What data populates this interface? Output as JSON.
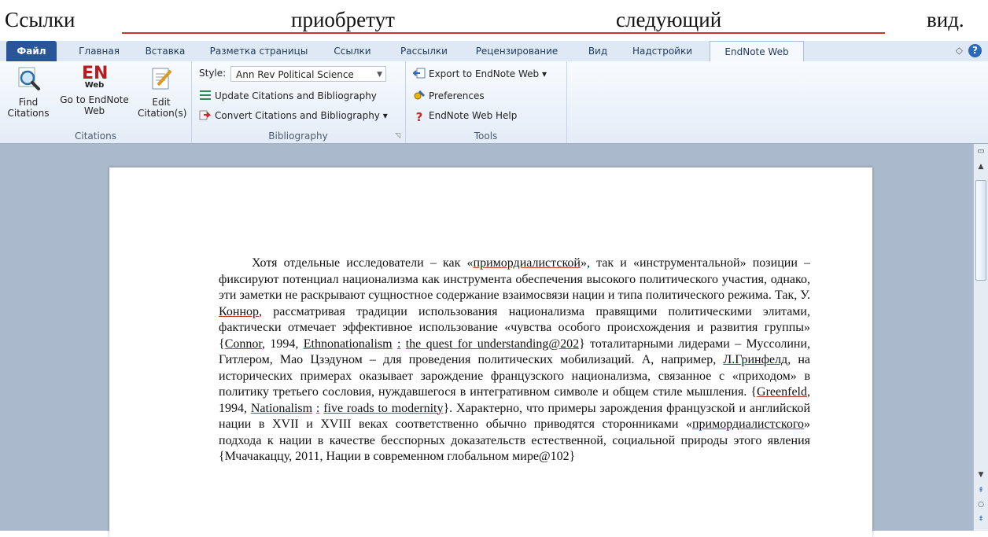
{
  "caption": {
    "words": [
      "Ссылки",
      "приобретут",
      "следующий",
      "вид."
    ]
  },
  "tabs": [
    {
      "label": "Файл"
    },
    {
      "label": "Главная"
    },
    {
      "label": "Вставка"
    },
    {
      "label": "Разметка страницы"
    },
    {
      "label": "Ссылки"
    },
    {
      "label": "Рассылки"
    },
    {
      "label": "Рецензирование"
    },
    {
      "label": "Вид"
    },
    {
      "label": "Надстройки"
    },
    {
      "label": "EndNote Web"
    }
  ],
  "help_label": "?",
  "ribbon": {
    "citations": {
      "label": "Citations",
      "find": "Find Citations",
      "goto": "Go to EndNote Web",
      "edit": "Edit Citation(s)",
      "en_logo": "EN",
      "en_sub": "Web"
    },
    "bibliography": {
      "label": "Bibliography",
      "style_label": "Style:",
      "style_value": "Ann Rev Political Science",
      "update": "Update Citations and Bibliography",
      "convert": "Convert Citations and Bibliography ▾"
    },
    "tools": {
      "label": "Tools",
      "export": "Export to EndNote Web ▾",
      "preferences": "Preferences",
      "help": "EndNote Web Help"
    }
  },
  "document": {
    "p1": "Хотя отдельные исследователи – как «",
    "w_prim1": "примордиалистской",
    "p2": "», так и «инструментальной» позиции – фиксируют потенциал национализма как инструмента обеспечения высокого политического участия, однако, эти заметки не раскрывают сущностное содержание взаимосвязи нации и типа политического режима. Так, У. ",
    "w_connor": "Коннор",
    "p3": ", рассматривая традиции использования национализма правящими политическими элитами, фактически отмечает эффективное использование «чувства особого происхождения и развития группы» {",
    "w_connor2": "Connor",
    "p4": ", 1994, ",
    "w_ethno": "Ethnonationalism",
    "p5": " ",
    "w_colon1": ":",
    "p6": " ",
    "w_quest": "the quest for understanding@202",
    "p7": "} тоталитарными лидерами – Муссолини, Гитлером, Мао Цзэдуном – для проведения политических мобилизаций. А, например, ",
    "w_green": "Л.Гринфелд",
    "p8": ", на исторических примерах оказывает зарождение французского национализма, связанное с «приходом» в политику третьего сословия, нуждавшегося в интегративном символе и общем стиле мышления. {",
    "w_green2": "Greenfeld",
    "p9": ", 1994, ",
    "w_nat": "Nationalism",
    "p10": " ",
    "w_colon2": ":",
    "p11": " ",
    "w_five": "five roads to modernity",
    "p12": "}. Характерно, что примеры зарождения французской и английской нации в XVII и XVIII веках соответственно обычно приводятся сторонниками «",
    "w_prim2": "примордиалистского",
    "p13": "» подхода к нации в качестве бесспорных доказательств естественной, социальной природы этого явления {Мчачакаццу, 2011, Нации в современном глобальном мире@102}"
  }
}
